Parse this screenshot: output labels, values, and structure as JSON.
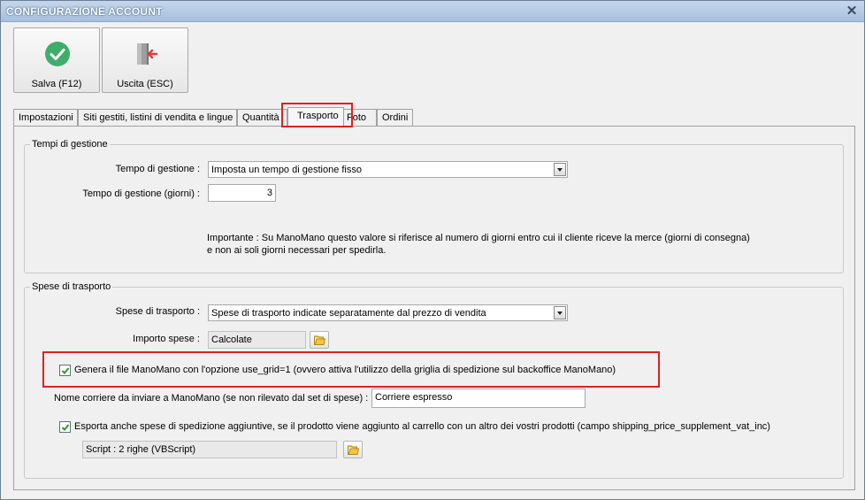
{
  "window": {
    "title": "CONFIGURAZIONE ACCOUNT"
  },
  "toolbar": {
    "save_label": "Salva (F12)",
    "exit_label": "Uscita (ESC)"
  },
  "tabs": [
    {
      "label": "Impostazioni",
      "active": false
    },
    {
      "label": "Siti gestiti, listini di vendita e lingue",
      "active": false
    },
    {
      "label": "Quantità",
      "active": false
    },
    {
      "label": "Trasporto",
      "active": true
    },
    {
      "label": "Foto",
      "active": false
    },
    {
      "label": "Ordini",
      "active": false
    }
  ],
  "handling": {
    "group_title": "Tempi di gestione",
    "time_label": "Tempo di gestione :",
    "time_value": "Imposta un tempo di gestione fisso",
    "days_label": "Tempo di gestione (giorni) :",
    "days_value": "3",
    "note_line1": "Importante : Su ManoMano questo valore si riferisce al numero di giorni entro cui il cliente riceve la merce (giorni di consegna)",
    "note_line2": "e non ai soli giorni necessari per spedirla."
  },
  "shipping": {
    "group_title": "Spese di trasporto",
    "costs_label": "Spese di trasporto :",
    "costs_value": "Spese di trasporto indicate separatamente dal prezzo di vendita",
    "amount_label": "Importo spese :",
    "amount_value": "Calcolate",
    "use_grid_label": "Genera il file ManoMano con l'opzione use_grid=1 (ovvero attiva l'utilizzo della griglia di spedizione sul backoffice ManoMano)",
    "use_grid_checked": true,
    "carrier_label": "Nome corriere da inviare a ManoMano (se non rilevato dal set di spese) :",
    "carrier_value": "Corriere espresso",
    "export_extra_label": "Esporta anche spese di spedizione aggiuntive, se il prodotto viene aggiunto al carrello con un altro dei vostri prodotti (campo shipping_price_supplement_vat_inc)",
    "export_extra_checked": true,
    "script_value": "Script : 2 righe (VBScript)"
  },
  "colors": {
    "highlight": "#e02020",
    "save_icon": "#3fae6a",
    "exit_icon_arrow": "#e53935"
  },
  "icons": {
    "save": "checkmark-circle-icon",
    "exit": "door-exit-icon",
    "folder": "folder-icon",
    "close": "close-icon"
  }
}
